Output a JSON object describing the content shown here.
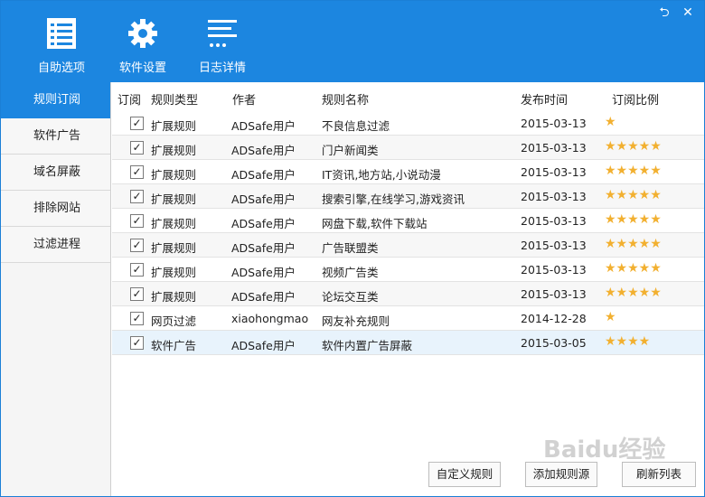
{
  "toolbar": {
    "items": [
      {
        "label": "自助选项",
        "icon": "checklist-icon"
      },
      {
        "label": "软件设置",
        "icon": "gear-icon"
      },
      {
        "label": "日志详情",
        "icon": "log-list-icon"
      }
    ],
    "controls": {
      "restore": "⮌",
      "close": "✕"
    }
  },
  "sidebar": {
    "items": [
      {
        "label": "规则订阅"
      },
      {
        "label": "软件广告"
      },
      {
        "label": "域名屏蔽"
      },
      {
        "label": "排除网站"
      },
      {
        "label": "过滤进程"
      }
    ]
  },
  "table": {
    "headers": [
      "订阅",
      "规则类型",
      "作者",
      "规则名称",
      "发布时间",
      "订阅比例"
    ],
    "rows": [
      {
        "checked": "✓",
        "type": "扩展规则",
        "author": "ADSafe用户",
        "name": "不良信息过滤",
        "date": "2015-03-13",
        "stars": "★",
        "rating": 1
      },
      {
        "checked": "✓",
        "type": "扩展规则",
        "author": "ADSafe用户",
        "name": "门户新闻类",
        "date": "2015-03-13",
        "stars": "★★★★★",
        "rating": 5
      },
      {
        "checked": "✓",
        "type": "扩展规则",
        "author": "ADSafe用户",
        "name": "IT资讯,地方站,小说动漫",
        "date": "2015-03-13",
        "stars": "★★★★★",
        "rating": 5
      },
      {
        "checked": "✓",
        "type": "扩展规则",
        "author": "ADSafe用户",
        "name": "搜索引擎,在线学习,游戏资讯",
        "date": "2015-03-13",
        "stars": "★★★★★",
        "rating": 5
      },
      {
        "checked": "✓",
        "type": "扩展规则",
        "author": "ADSafe用户",
        "name": "网盘下载,软件下载站",
        "date": "2015-03-13",
        "stars": "★★★★★",
        "rating": 5
      },
      {
        "checked": "✓",
        "type": "扩展规则",
        "author": "ADSafe用户",
        "name": "广告联盟类",
        "date": "2015-03-13",
        "stars": "★★★★★",
        "rating": 5
      },
      {
        "checked": "✓",
        "type": "扩展规则",
        "author": "ADSafe用户",
        "name": "视频广告类",
        "date": "2015-03-13",
        "stars": "★★★★★",
        "rating": 5
      },
      {
        "checked": "✓",
        "type": "扩展规则",
        "author": "ADSafe用户",
        "name": "论坛交互类",
        "date": "2015-03-13",
        "stars": "★★★★★",
        "rating": 5
      },
      {
        "checked": "✓",
        "type": "网页过滤",
        "author": "xiaohongmao",
        "name": "网友补充规则",
        "date": "2014-12-28",
        "stars": "★",
        "rating": 1
      },
      {
        "checked": "✓",
        "type": "软件广告",
        "author": "ADSafe用户",
        "name": "软件内置广告屏蔽",
        "date": "2015-03-05",
        "stars": "★★★★",
        "rating": 4
      }
    ]
  },
  "buttons": {
    "custom_rule": "自定义规则",
    "add_source": "添加规则源",
    "refresh": "刷新列表"
  },
  "watermark": "Baidu经验",
  "colors": {
    "accent": "#1c86e0",
    "star": "#f2b030"
  }
}
